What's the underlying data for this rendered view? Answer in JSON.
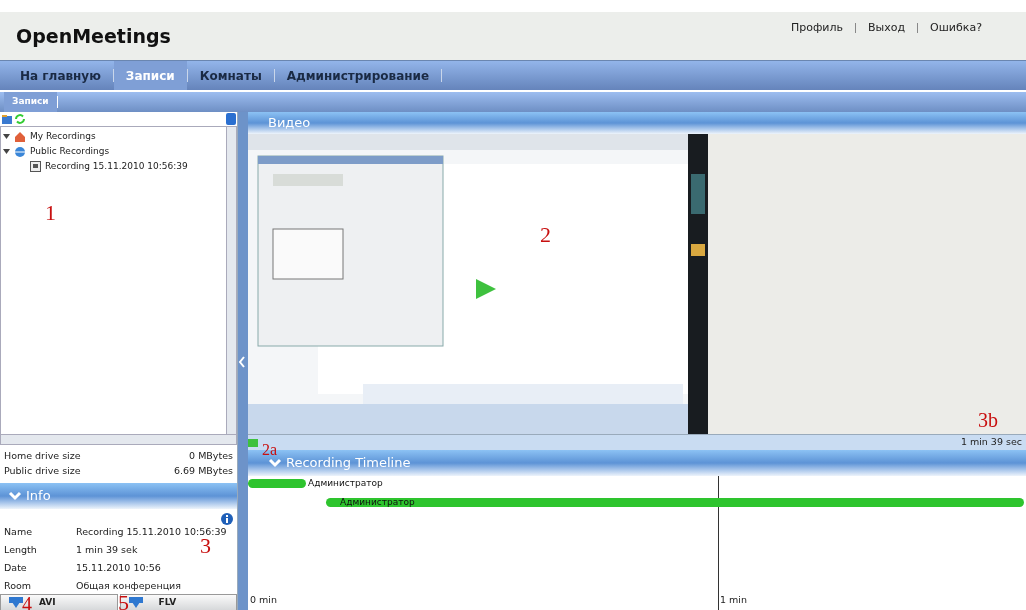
{
  "header": {
    "logo": "OpenMeetings",
    "links": [
      "Профиль",
      "Выход",
      "Ошибка?"
    ]
  },
  "nav": {
    "tabs": [
      {
        "label": "На главную",
        "selected": false
      },
      {
        "label": "Записи",
        "selected": true
      },
      {
        "label": "Комнаты",
        "selected": false
      },
      {
        "label": "Администрирование",
        "selected": false
      }
    ]
  },
  "subnav": {
    "tabs": [
      {
        "label": "Записи",
        "selected": true
      }
    ]
  },
  "tree": [
    {
      "label": "My Recordings",
      "kind": "home",
      "expanded": true
    },
    {
      "label": "Public Recordings",
      "kind": "public",
      "expanded": true,
      "children": [
        {
          "label": "Recording 15.11.2010 10:56:39",
          "kind": "recording"
        }
      ]
    }
  ],
  "drives": [
    {
      "label": "Home drive size",
      "value": "0 MBytes"
    },
    {
      "label": "Public drive size",
      "value": "6.69 MBytes"
    }
  ],
  "info": {
    "title": "Info",
    "rows": [
      {
        "label": "Name",
        "value": "Recording 15.11.2010 10:56:39"
      },
      {
        "label": "Length",
        "value": "1 min 39 sek"
      },
      {
        "label": "Date",
        "value": "15.11.2010 10:56"
      },
      {
        "label": "Room",
        "value": "Общая конференция"
      }
    ]
  },
  "downloads": [
    "AVI",
    "FLV"
  ],
  "video": {
    "title": "Видео",
    "duration": "1 min 39 sec"
  },
  "timeline": {
    "title": "Recording Timeline",
    "tracks": [
      {
        "label": "Администратор"
      },
      {
        "label": "Администратор"
      }
    ],
    "ticks": [
      "0 min",
      "1 min"
    ]
  },
  "annotations": [
    "1",
    "2",
    "2a",
    "3",
    "3b",
    "4",
    "5"
  ]
}
